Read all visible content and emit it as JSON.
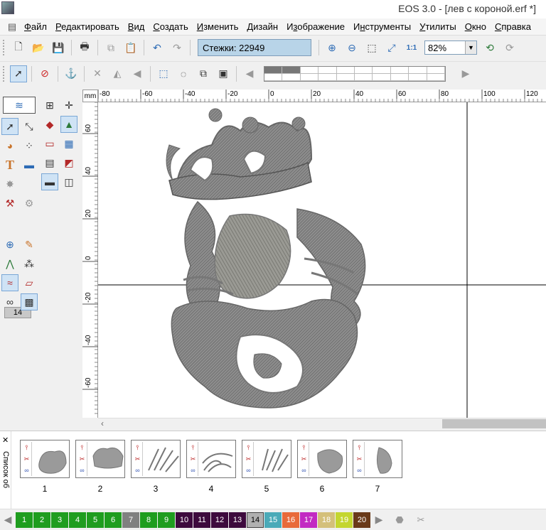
{
  "window": {
    "title": "EOS 3.0 - [лев с короной.erf *]"
  },
  "menu": [
    {
      "label": "Файл",
      "u": "Ф"
    },
    {
      "label": "Редактировать",
      "u": "Р"
    },
    {
      "label": "Вид",
      "u": "В"
    },
    {
      "label": "Создать",
      "u": "С"
    },
    {
      "label": "Изменить",
      "u": "И"
    },
    {
      "label": "Дизайн",
      "u": "Д"
    },
    {
      "label": "Изображение",
      "u": "з"
    },
    {
      "label": "Инструменты",
      "u": "н"
    },
    {
      "label": "Утилиты",
      "u": "У"
    },
    {
      "label": "Окно",
      "u": "О"
    },
    {
      "label": "Справка",
      "u": "С"
    }
  ],
  "toolbar": {
    "stitches_label": "Стежки: 22949",
    "zoom_value": "82%"
  },
  "left_panel": {
    "density_value": "14"
  },
  "rulers": {
    "unit": "mm",
    "h_ticks": [
      "-80",
      "-60",
      "-40",
      "-20",
      "0",
      "20",
      "40",
      "60",
      "80",
      "100",
      "120"
    ],
    "v_ticks": [
      "60",
      "40",
      "20",
      "0",
      "-20",
      "-40",
      "-60"
    ]
  },
  "object_list": {
    "label": "Список об",
    "close_label": "✕",
    "items": [
      {
        "num": "1"
      },
      {
        "num": "2"
      },
      {
        "num": "3"
      },
      {
        "num": "4"
      },
      {
        "num": "5"
      },
      {
        "num": "6"
      },
      {
        "num": "7"
      }
    ]
  },
  "colors": {
    "swatches": [
      {
        "num": "1",
        "color": "#1f9d1f"
      },
      {
        "num": "2",
        "color": "#1f9d1f"
      },
      {
        "num": "3",
        "color": "#1f9d1f"
      },
      {
        "num": "4",
        "color": "#1f9d1f"
      },
      {
        "num": "5",
        "color": "#1f9d1f"
      },
      {
        "num": "6",
        "color": "#1f9d1f"
      },
      {
        "num": "7",
        "color": "#808080"
      },
      {
        "num": "8",
        "color": "#1f9d1f"
      },
      {
        "num": "9",
        "color": "#1f9d1f"
      },
      {
        "num": "10",
        "color": "#3d0a3d"
      },
      {
        "num": "11",
        "color": "#3d0a3d"
      },
      {
        "num": "12",
        "color": "#3d0a3d"
      },
      {
        "num": "13",
        "color": "#3d0a3d"
      },
      {
        "num": "14",
        "color": "#b0b0b0"
      },
      {
        "num": "15",
        "color": "#4aaab8"
      },
      {
        "num": "16",
        "color": "#e86a3a"
      },
      {
        "num": "17",
        "color": "#c22ac2"
      },
      {
        "num": "18",
        "color": "#d4c07a"
      },
      {
        "num": "19",
        "color": "#c4d630"
      },
      {
        "num": "20",
        "color": "#6a3a1a"
      }
    ],
    "selected": "14"
  },
  "accent": "#2d6bb5"
}
